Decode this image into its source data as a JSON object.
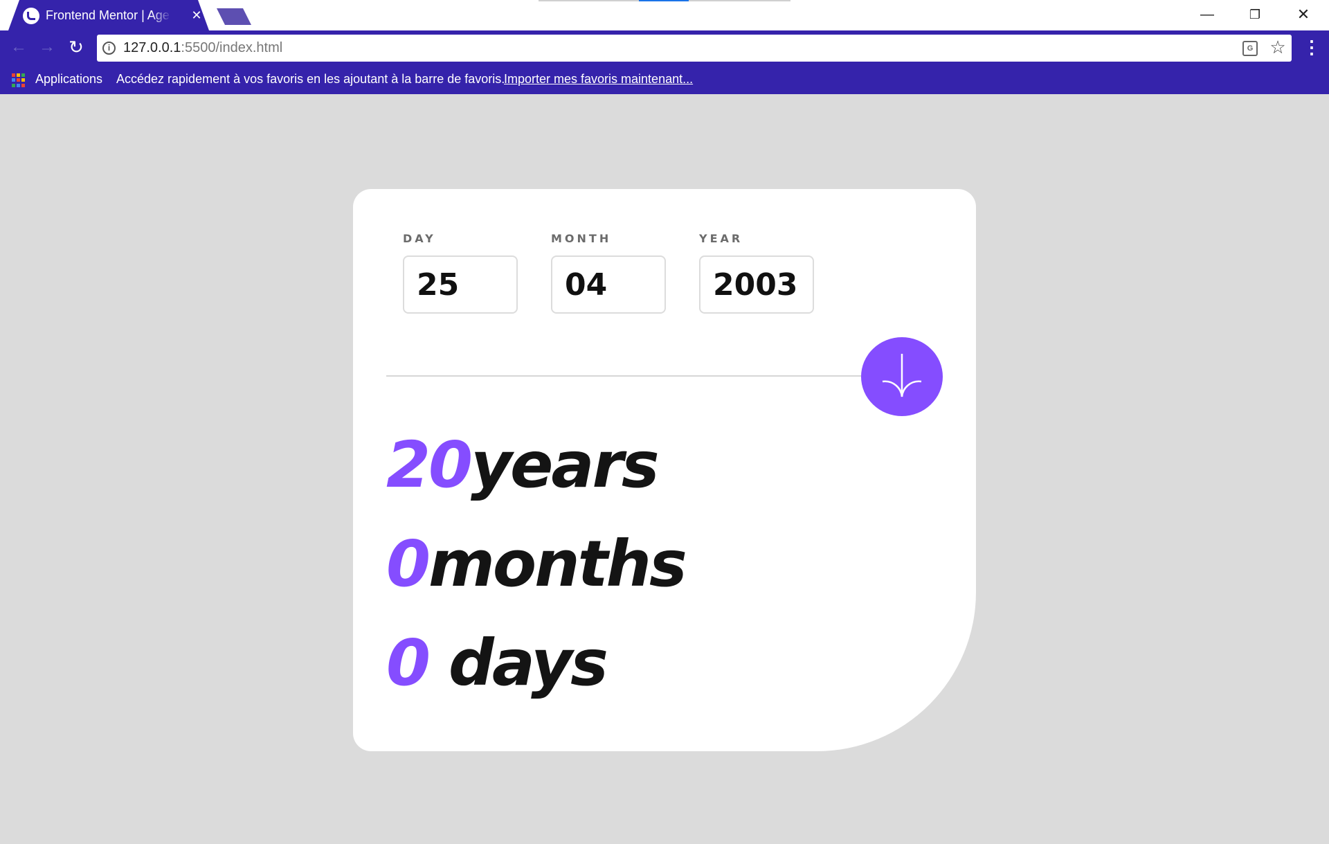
{
  "browser": {
    "tab_title": "Frontend Mentor | Age calculator app",
    "tab_close": "✕",
    "url_host": "127.0.0.1",
    "url_path": ":5500/index.html",
    "win_minimize": "—",
    "win_restore": "❐",
    "win_close": "✕",
    "nav_back": "←",
    "nav_forward": "→",
    "nav_reload": "↻",
    "info": "i",
    "star": "☆",
    "menu": "⋮",
    "translate": "G",
    "bookmarks": {
      "apps_label": "Applications",
      "hint": "Accédez rapidement à vos favoris en les ajoutant à la barre de favoris.",
      "import_link": "Importer mes favoris maintenant..."
    },
    "apps_colors": [
      "#ea4335",
      "#fbbc05",
      "#34a853",
      "#4285f4",
      "#ea4335",
      "#fbbc05",
      "#34a853",
      "#4285f4",
      "#ea4335"
    ]
  },
  "form": {
    "day": {
      "label": "DAY",
      "value": "25"
    },
    "month": {
      "label": "MONTH",
      "value": "04"
    },
    "year": {
      "label": "YEAR",
      "value": "2003"
    }
  },
  "submit": {
    "icon": "arrow-down-icon"
  },
  "results": {
    "years": {
      "value": "20",
      "unit": "years"
    },
    "months": {
      "value": "0",
      "unit": "months"
    },
    "days": {
      "value": "0",
      "unit": " days"
    }
  },
  "colors": {
    "accent": "#854dff",
    "chrome": "#3523ab",
    "background": "#dbdbdb",
    "text": "#141414"
  }
}
